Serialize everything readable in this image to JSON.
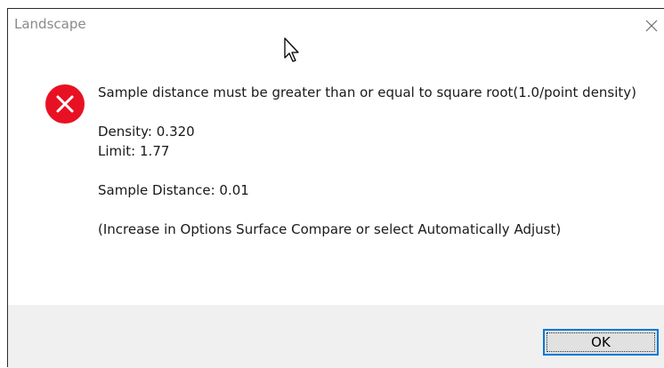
{
  "window": {
    "title": "Landscape",
    "close_icon": "close-icon"
  },
  "message": {
    "icon": "error-icon",
    "line1": "Sample distance must be greater than or equal to square root(1.0/point density)",
    "density": "Density: 0.320",
    "limit": "Limit: 1.77",
    "sample_distance": "Sample Distance: 0.01",
    "hint": "(Increase in Options Surface Compare or select Automatically Adjust)"
  },
  "buttons": {
    "ok_label": "OK"
  },
  "colors": {
    "error_red": "#e81123",
    "accent_blue": "#0078d7",
    "footer_bg": "#f0f0f0"
  }
}
